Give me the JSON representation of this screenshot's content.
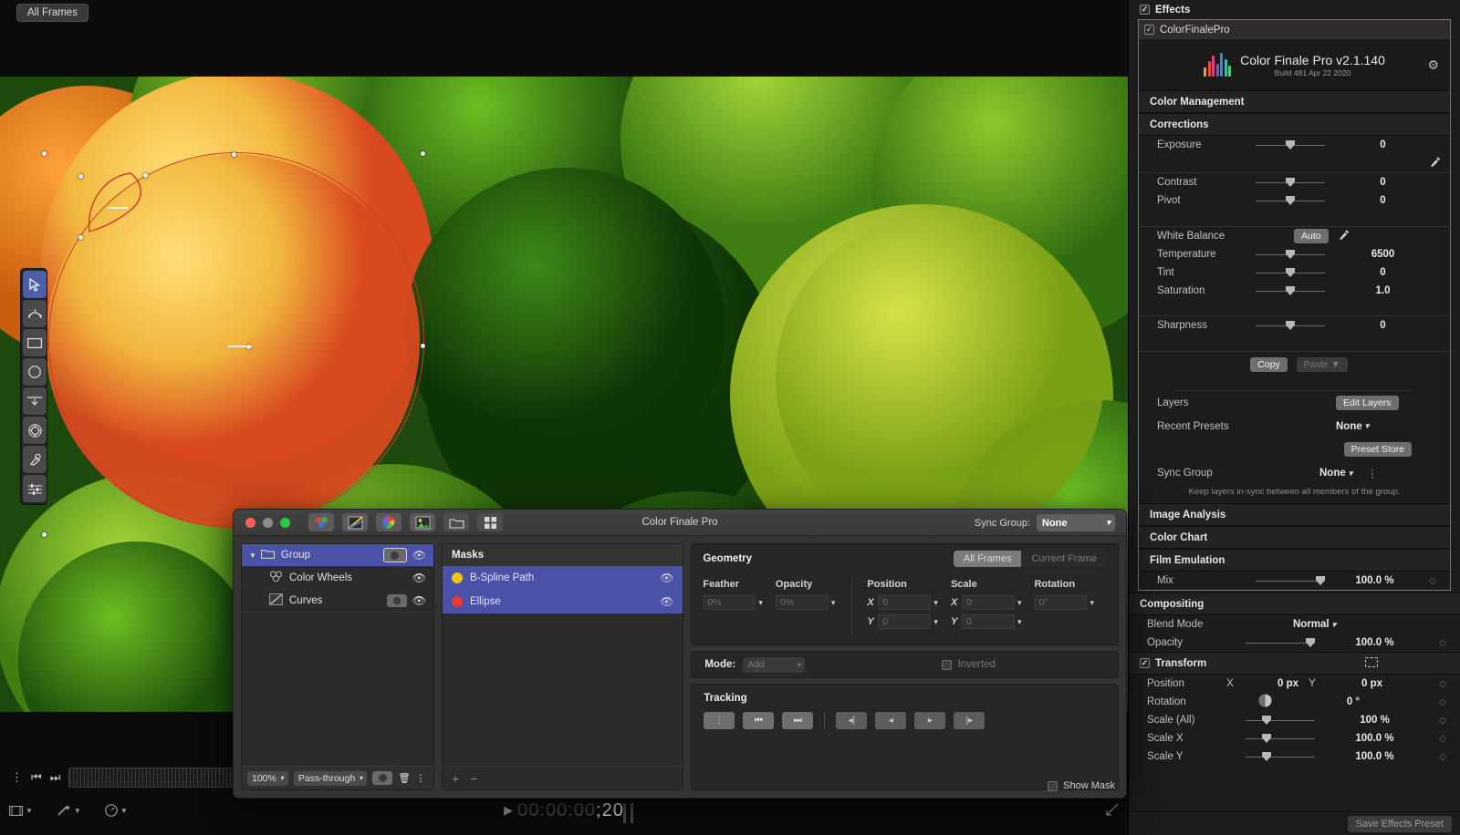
{
  "viewer": {
    "all_frames_button": "All Frames",
    "timecode": {
      "prefix": "00:00:00",
      "frames": "20",
      "play_glyph": "▶"
    },
    "tools": [
      {
        "name": "select-tool",
        "selected": true
      },
      {
        "name": "bspline-pen-tool",
        "selected": false
      },
      {
        "name": "rectangle-mask-tool",
        "selected": false
      },
      {
        "name": "ellipse-mask-tool",
        "selected": false
      },
      {
        "name": "gradient-mask-tool",
        "selected": false
      },
      {
        "name": "color-mask-tool",
        "selected": false
      },
      {
        "name": "eyedropper-tool",
        "selected": false
      },
      {
        "name": "adjust-sliders-tool",
        "selected": false
      }
    ]
  },
  "inspector": {
    "effects_label": "Effects",
    "plugin_label": "ColorFinalePro",
    "brand": {
      "title": "Color Finale Pro v2.1.140",
      "build": "Build 481 Apr 22 2020"
    },
    "sections": {
      "color_management": "Color Management",
      "corrections": "Corrections",
      "image_analysis": "Image Analysis",
      "color_chart": "Color Chart",
      "film_emulation": "Film Emulation",
      "compositing": "Compositing",
      "transform": "Transform"
    },
    "corrections": [
      {
        "label": "Exposure",
        "value": "0",
        "knob": 50
      },
      {
        "label": "Contrast",
        "value": "0",
        "knob": 50
      },
      {
        "label": "Pivot",
        "value": "0",
        "knob": 50
      }
    ],
    "white_balance": {
      "label": "White Balance",
      "auto_button": "Auto",
      "params": [
        {
          "label": "Temperature",
          "value": "6500",
          "knob": 50
        },
        {
          "label": "Tint",
          "value": "0",
          "knob": 50
        },
        {
          "label": "Saturation",
          "value": "1.0",
          "knob": 50
        }
      ]
    },
    "sharpness": {
      "label": "Sharpness",
      "value": "0",
      "knob": 50
    },
    "copy_button": "Copy",
    "paste_button": "Paste ▼",
    "layers": {
      "label": "Layers",
      "button": "Edit Layers"
    },
    "recent_presets": {
      "label": "Recent Presets",
      "value": "None"
    },
    "preset_store_button": "Preset Store",
    "sync_group": {
      "label": "Sync Group",
      "value": "None"
    },
    "sync_hint": "Keep layers in-sync between all members of the group.",
    "film_emulation": {
      "label": "Mix",
      "value": "100.0 %",
      "knob": 88
    },
    "compositing": {
      "blend_mode": {
        "label": "Blend Mode",
        "value": "Normal"
      },
      "opacity": {
        "label": "Opacity",
        "value": "100.0 %",
        "knob": 88
      }
    },
    "transform": [
      {
        "label": "Position",
        "axis_x": "X",
        "value_x": "0 px",
        "axis_y": "Y",
        "value_y": "0 px"
      },
      {
        "label": "Rotation",
        "value": "0 °"
      },
      {
        "label": "Scale (All)",
        "value": "100 %",
        "knob": 28
      },
      {
        "label": "Scale X",
        "value": "100.0 %",
        "knob": 28
      },
      {
        "label": "Scale Y",
        "value": "100.0 %",
        "knob": 28
      }
    ],
    "save_preset_button": "Save Effects Preset"
  },
  "cfp_window": {
    "title": "Color Finale Pro",
    "sync_group_label": "Sync Group:",
    "sync_group_value": "None",
    "toolbar_icons": [
      "color-wheels-icon",
      "curves-icon",
      "color-hue-wheel-icon",
      "image-adjust-icon",
      "folder-icon",
      "grid-layout-icon"
    ],
    "layers": [
      {
        "name": "Group",
        "selected": true,
        "has_mask": true,
        "disclosure": "▼"
      },
      {
        "name": "Color Wheels",
        "selected": false,
        "has_mask": false
      },
      {
        "name": "Curves",
        "selected": false,
        "has_mask": true
      }
    ],
    "layer_footer": {
      "zoom": "100%",
      "blend": "Pass-through"
    },
    "masks_header": "Masks",
    "masks": [
      {
        "name": "B-Spline Path",
        "color": "#f2c511",
        "selected": true
      },
      {
        "name": "Ellipse",
        "color": "#ee3b30",
        "selected": true
      }
    ],
    "geometry": {
      "title": "Geometry",
      "seg_all": "All Frames",
      "seg_current": "Current Frame",
      "feather": {
        "label": "Feather",
        "value": "0%"
      },
      "opacity": {
        "label": "Opacity",
        "value": "0%"
      },
      "position": {
        "label": "Position",
        "x": "0",
        "y": "0"
      },
      "scale": {
        "label": "Scale",
        "x": "0",
        "y": "0"
      },
      "rotation": {
        "label": "Rotation",
        "value": "0°"
      }
    },
    "mode": {
      "label": "Mode:",
      "value": "Add",
      "inverted_label": "Inverted"
    },
    "tracking": {
      "label": "Tracking"
    },
    "show_mask_label": "Show Mask"
  }
}
